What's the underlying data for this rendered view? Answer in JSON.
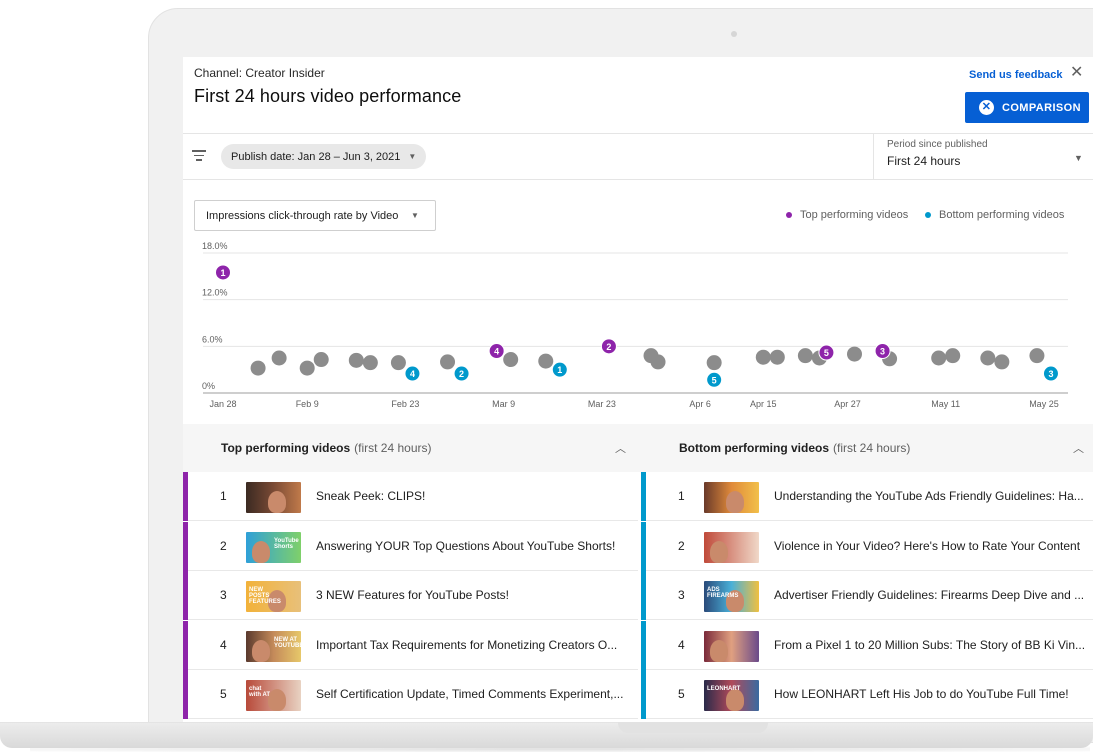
{
  "header": {
    "channel": "Channel: Creator Insider",
    "title": "First 24 hours video performance",
    "feedback": "Send us feedback",
    "comparison_button": "COMPARISON"
  },
  "filters": {
    "publish_date": "Publish date: Jan 28 – Jun 3, 2021",
    "period_label": "Period since published",
    "period_value": "First 24 hours"
  },
  "metric_select": "Impressions click-through rate by Video",
  "legend": {
    "top": "Top performing videos",
    "bottom": "Bottom performing videos"
  },
  "colors": {
    "top": "#8e24aa",
    "bottom": "#0099cc",
    "other": "#8c8c8c",
    "accent": "#065fd4"
  },
  "chart_data": {
    "type": "scatter",
    "ylabel": "",
    "xlabel": "",
    "yticks": [
      "18.0%",
      "12.0%",
      "6.0%",
      "0%"
    ],
    "ylim": [
      0,
      18
    ],
    "xtick_labels": [
      "Jan 28",
      "Feb 9",
      "Feb 23",
      "Mar 9",
      "Mar 23",
      "Apr 6",
      "Apr 15",
      "Apr 27",
      "May 11",
      "May 25"
    ],
    "grid": true,
    "legend_position": "top-right",
    "series": [
      {
        "name": "Top performing videos",
        "points": [
          {
            "x": "Jan 28",
            "y": 15.5,
            "label": "1"
          },
          {
            "x": "Mar 24",
            "y": 6.0,
            "label": "2"
          },
          {
            "x": "May 2",
            "y": 5.4,
            "label": "3"
          },
          {
            "x": "Mar 8",
            "y": 5.4,
            "label": "4"
          },
          {
            "x": "Apr 24",
            "y": 5.2,
            "label": "5"
          }
        ]
      },
      {
        "name": "Bottom performing videos",
        "points": [
          {
            "x": "Mar 17",
            "y": 3.0,
            "label": "1"
          },
          {
            "x": "Mar 3",
            "y": 2.5,
            "label": "2"
          },
          {
            "x": "May 26",
            "y": 2.5,
            "label": "3"
          },
          {
            "x": "Feb 24",
            "y": 2.5,
            "label": "4"
          },
          {
            "x": "Apr 8",
            "y": 1.7,
            "label": "5"
          }
        ]
      },
      {
        "points": [
          {
            "x": "Feb 2",
            "y": 3.2
          },
          {
            "x": "Feb 5",
            "y": 4.5
          },
          {
            "x": "Feb 9",
            "y": 3.2
          },
          {
            "x": "Feb 11",
            "y": 4.3
          },
          {
            "x": "Feb 16",
            "y": 4.2
          },
          {
            "x": "Feb 18",
            "y": 3.9
          },
          {
            "x": "Feb 22",
            "y": 3.9
          },
          {
            "x": "Mar 1",
            "y": 4.0
          },
          {
            "x": "Mar 10",
            "y": 4.3
          },
          {
            "x": "Mar 15",
            "y": 4.1
          },
          {
            "x": "Mar 30",
            "y": 4.8
          },
          {
            "x": "Mar 31",
            "y": 4.0
          },
          {
            "x": "Apr 8",
            "y": 3.9
          },
          {
            "x": "Apr 15",
            "y": 4.6
          },
          {
            "x": "Apr 17",
            "y": 4.6
          },
          {
            "x": "Apr 21",
            "y": 4.8
          },
          {
            "x": "Apr 23",
            "y": 4.5
          },
          {
            "x": "Apr 28",
            "y": 5.0
          },
          {
            "x": "May 3",
            "y": 4.4
          },
          {
            "x": "May 10",
            "y": 4.5
          },
          {
            "x": "May 12",
            "y": 4.8
          },
          {
            "x": "May 17",
            "y": 4.5
          },
          {
            "x": "May 19",
            "y": 4.0
          },
          {
            "x": "May 24",
            "y": 4.8
          }
        ]
      }
    ]
  },
  "top_table": {
    "title": "Top performing videos",
    "subtitle": "(first 24 hours)",
    "rows": [
      {
        "rank": "1",
        "title": "Sneak Peek: CLIPS!"
      },
      {
        "rank": "2",
        "title": "Answering YOUR Top Questions About YouTube Shorts!"
      },
      {
        "rank": "3",
        "title": "3 NEW Features for YouTube Posts!"
      },
      {
        "rank": "4",
        "title": "Important Tax Requirements for Monetizing Creators O..."
      },
      {
        "rank": "5",
        "title": "Self Certification Update, Timed Comments Experiment,..."
      }
    ]
  },
  "bottom_table": {
    "title": "Bottom performing videos",
    "subtitle": "(first 24 hours)",
    "rows": [
      {
        "rank": "1",
        "title": "Understanding the YouTube Ads Friendly Guidelines: Ha..."
      },
      {
        "rank": "2",
        "title": "Violence in Your Video? Here's How to Rate Your Content"
      },
      {
        "rank": "3",
        "title": "Advertiser Friendly Guidelines: Firearms Deep Dive and ..."
      },
      {
        "rank": "4",
        "title": "From a Pixel 1 to 20 Million Subs: The Story of BB Ki Vin..."
      },
      {
        "rank": "5",
        "title": "How LEONHART Left His Job to do YouTube Full Time!"
      }
    ]
  },
  "thumbnail_text": {
    "top_2": "YouTube Shorts",
    "top_3": "NEW POSTS FEATURES",
    "top_4": "NEW AT YOUTUBE",
    "top_5": "chat with AT",
    "bottom_3": "ADS FIREARMS",
    "bottom_5": "LEONHART"
  },
  "icons": {
    "close": "close-icon",
    "filter": "filter-icon",
    "comparison": "close-circle-icon",
    "dropdown": "caret-down-icon",
    "collapse": "chevron-up-icon"
  }
}
